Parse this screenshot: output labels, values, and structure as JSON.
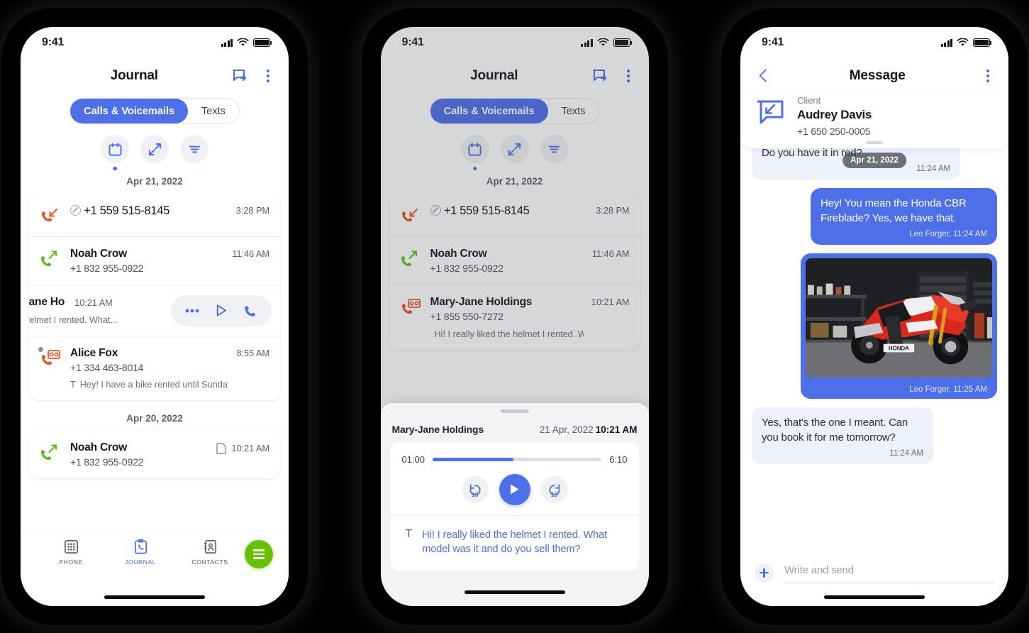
{
  "accent_blue": "#4d6fe8",
  "accent_green": "#67c000",
  "missed_red": "#e8502a",
  "outgoing_green": "#5bbb1a",
  "phone1": {
    "status": {
      "time": "9:41"
    },
    "nav": {
      "title": "Journal",
      "compose_icon": "message-out-icon",
      "menu_icon": "kebab-menu-icon"
    },
    "segmented": {
      "options": [
        "Calls & Voicemails",
        "Texts"
      ],
      "selected": "Calls & Voicemails"
    },
    "filters": [
      {
        "name": "calendar-filter",
        "icon": "calendar-icon",
        "active": true
      },
      {
        "name": "direction-filter",
        "icon": "arrows-diagonal-icon",
        "active": false
      },
      {
        "name": "sort-filter",
        "icon": "filter-lines-icon",
        "active": false
      }
    ],
    "groups": [
      {
        "date": "Apr 21, 2022",
        "rows": [
          {
            "type": "missed-blocked",
            "name": "+1 559 515-8145",
            "sub": "",
            "time": "3:28 PM",
            "note": "",
            "blocked": true
          },
          {
            "type": "outgoing",
            "name": "Noah Crow",
            "sub": "+1 832 955-0922",
            "time": "11:46 AM",
            "note": ""
          },
          {
            "type": "voicemail-swiped",
            "name": "ry-Jane Ho",
            "sub": "",
            "time": "10:21 AM",
            "note": "the helmet I rented. What...",
            "actions": [
              "more-icon",
              "play-icon",
              "call-icon"
            ]
          },
          {
            "type": "voicemail",
            "name": "Alice Fox",
            "sub": "+1 334 463-8014",
            "time": "8:55 AM",
            "note": "Hey! I have a bike rented until Sunday...",
            "note_icon": "T",
            "unread": true
          }
        ]
      },
      {
        "date": "Apr 20, 2022",
        "rows": [
          {
            "type": "outgoing",
            "name": "Noah Crow",
            "sub": "+1 832 955-0922",
            "time": "10:21 AM",
            "note": "",
            "time_icon": "note-icon"
          }
        ]
      }
    ],
    "tabs": [
      {
        "label": "PHONE",
        "icon": "keypad-icon",
        "active": false
      },
      {
        "label": "JOURNAL",
        "icon": "clipboard-phone-icon",
        "active": true
      },
      {
        "label": "CONTACTS",
        "icon": "contacts-book-icon",
        "active": false
      }
    ],
    "fab": {
      "name": "menu-fab",
      "icon": "hamburger-icon"
    }
  },
  "phone2": {
    "status": {
      "time": "9:41"
    },
    "nav": {
      "title": "Journal",
      "compose_icon": "message-out-icon",
      "menu_icon": "kebab-menu-icon"
    },
    "segmented": {
      "options": [
        "Calls & Voicemails",
        "Texts"
      ],
      "selected": "Calls & Voicemails"
    },
    "filters": [
      {
        "name": "calendar-filter",
        "icon": "calendar-icon",
        "active": true
      },
      {
        "name": "direction-filter",
        "icon": "arrows-diagonal-icon",
        "active": false
      },
      {
        "name": "sort-filter",
        "icon": "filter-lines-icon",
        "active": false
      }
    ],
    "groups": [
      {
        "date": "Apr 21, 2022",
        "rows": [
          {
            "type": "missed-blocked",
            "name": "+1 559 515-8145",
            "sub": "",
            "time": "3:28 PM",
            "blocked": true
          },
          {
            "type": "outgoing",
            "name": "Noah Crow",
            "sub": "+1 832 955-0922",
            "time": "11:46 AM"
          },
          {
            "type": "voicemail",
            "name": "Mary-Jane Holdings",
            "sub": "+1 855 550-7272",
            "time": "10:21 AM",
            "note": "Hi! I really liked the helmet I rented. What...",
            "note_icon": "note-icon"
          }
        ]
      }
    ],
    "sheet": {
      "title": "Mary-Jane Holdings",
      "date": "21 Apr, 2022",
      "time": "10:21 AM",
      "player": {
        "elapsed": "01:00",
        "duration": "6:10",
        "progress_percent": 48,
        "rewind_label": "15",
        "forward_label": "15",
        "play_icon": "play-icon"
      },
      "transcript": {
        "badge": "T",
        "text": "Hi! I really liked the helmet I rented. What model was it and do you sell them?"
      }
    }
  },
  "phone3": {
    "status": {
      "time": "9:41"
    },
    "nav": {
      "title": "Message",
      "back_icon": "chevron-left-icon",
      "menu_icon": "kebab-menu-icon"
    },
    "contact": {
      "role": "Client",
      "name": "Audrey Davis",
      "phone": "+1 650 250-0005",
      "avatar_icon": "message-in-icon"
    },
    "date_pill": "Apr 21, 2022",
    "messages": [
      {
        "dir": "in",
        "text": "Hi! I'm interested in renting a Honda Fire. Do you have it in red?",
        "meta": "11:24 AM",
        "kind": "text"
      },
      {
        "dir": "out",
        "text": "Hey! You mean the Honda CBR Fireblade? Yes, we have that.",
        "meta": "Leo Forger, 11:24 AM",
        "kind": "text"
      },
      {
        "dir": "out",
        "text": "",
        "meta": "Leo Forger, 11:25 AM",
        "kind": "image",
        "image_alt": "Red Honda CBR motorcycle in a garage"
      },
      {
        "dir": "in",
        "text": "Yes, that's the one I meant. Can you book it for me tomorrow?",
        "meta": "11:24 AM",
        "kind": "text"
      }
    ],
    "composer": {
      "placeholder": "Write and send",
      "add_icon": "plus-icon"
    }
  }
}
